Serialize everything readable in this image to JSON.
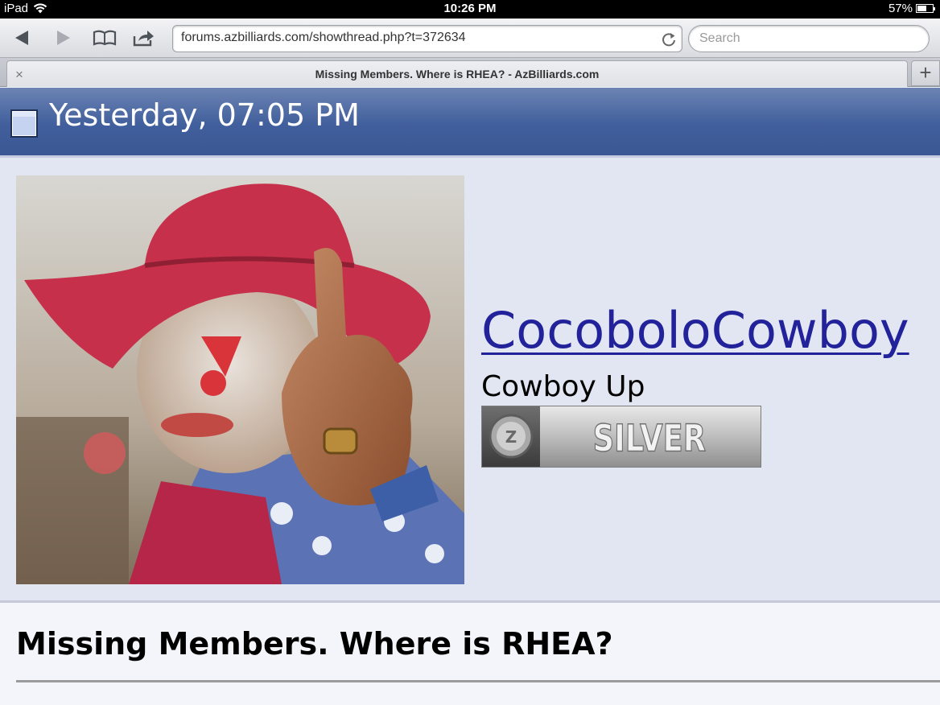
{
  "status_bar": {
    "device": "iPad",
    "time": "10:26 PM",
    "battery": "57%",
    "battery_level": 0.57
  },
  "browser": {
    "url": "forums.azbilliards.com/showthread.php?t=372634",
    "search_placeholder": "Search",
    "tab_title": "Missing Members. Where is RHEA? - AzBilliards.com",
    "tab_close": "×",
    "new_tab": "+"
  },
  "post": {
    "date": "Yesterday, 07:05 PM",
    "username": "CocoboloCowboy",
    "user_title": "Cowboy Up",
    "rank_label": "SILVER",
    "rank_emblem": "Z",
    "thread_title": "Missing Members. Where is RHEA?"
  },
  "colors": {
    "header_blue": "#415f9c",
    "username_link": "#22229a",
    "userinfo_bg": "#e2e6f3",
    "hat_red": "#c7304a"
  }
}
